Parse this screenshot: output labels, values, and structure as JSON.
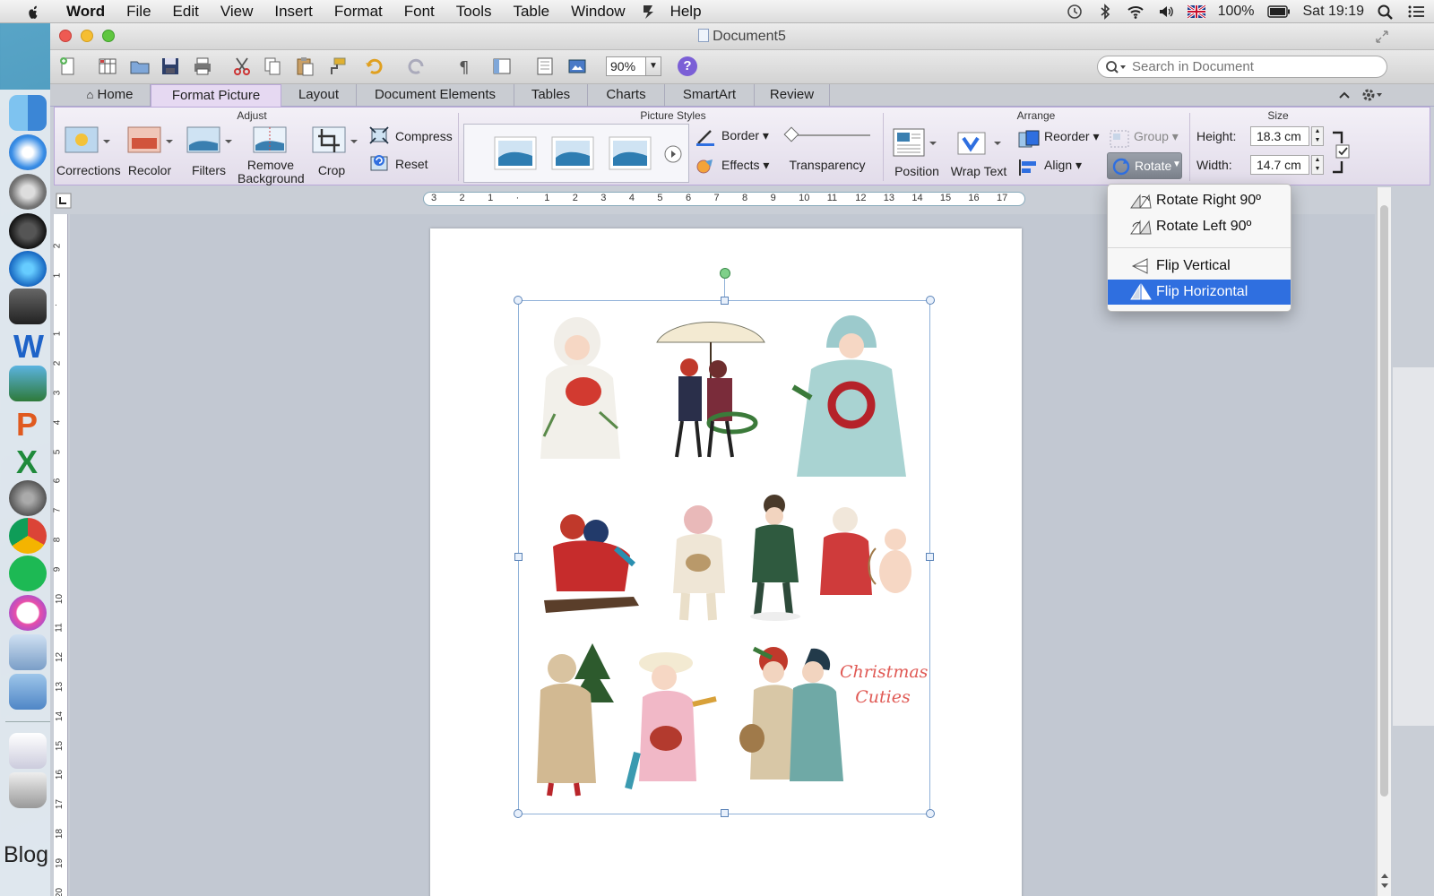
{
  "menubar": {
    "app": "Word",
    "items": [
      "File",
      "Edit",
      "View",
      "Insert",
      "Format",
      "Font",
      "Tools",
      "Table",
      "Window",
      "Help"
    ],
    "status": {
      "battery": "100%",
      "clock": "Sat 19:19"
    }
  },
  "dock": {
    "blog_label": "Blog"
  },
  "window": {
    "title": "Document5"
  },
  "toolbar": {
    "zoom": "90%",
    "help": "?",
    "search_placeholder": "Search in Document"
  },
  "ribbon_tabs": [
    "Home",
    "Format Picture",
    "Layout",
    "Document Elements",
    "Tables",
    "Charts",
    "SmartArt",
    "Review"
  ],
  "ribbon": {
    "adjust": {
      "title": "Adjust",
      "corrections": "Corrections",
      "recolor": "Recolor",
      "filters": "Filters",
      "remove_background_1": "Remove",
      "remove_background_2": "Background",
      "crop": "Crop",
      "compress": "Compress",
      "reset": "Reset"
    },
    "picture_styles": {
      "title": "Picture Styles",
      "border": "Border",
      "effects": "Effects",
      "transparency": "Transparency"
    },
    "arrange": {
      "title": "Arrange",
      "position": "Position",
      "wrap_text": "Wrap Text",
      "reorder": "Reorder",
      "align": "Align",
      "group": "Group",
      "rotate": "Rotate"
    },
    "size": {
      "title": "Size",
      "height_label": "Height:",
      "height_value": "18.3 cm",
      "width_label": "Width:",
      "width_value": "14.7 cm"
    }
  },
  "ruler": {
    "h_labels": [
      "3",
      "2",
      "1",
      "",
      "1",
      "2",
      "3",
      "4",
      "5",
      "6",
      "7",
      "8",
      "9",
      "10",
      "11",
      "12",
      "13",
      "14",
      "15",
      "16",
      "17"
    ],
    "v_labels": [
      "2",
      "1",
      "",
      "1",
      "2",
      "3",
      "4",
      "5",
      "6",
      "7",
      "8",
      "9",
      "10",
      "11",
      "12",
      "13",
      "14",
      "15",
      "16",
      "17",
      "18",
      "19",
      "20"
    ]
  },
  "document": {
    "caption_line1": "Christmas",
    "caption_line2": "Cuties"
  },
  "rotate_menu": {
    "items": [
      {
        "label": "Rotate Right 90º",
        "selected": false
      },
      {
        "label": "Rotate Left 90º",
        "selected": false
      },
      {
        "label": "Flip Vertical",
        "selected": false
      },
      {
        "label": "Flip Horizontal",
        "selected": true
      }
    ]
  },
  "colors": {
    "ribbon_accent": "#b9a8d8",
    "selection_blue": "#2f6fe0",
    "caption_red": "#e05a55"
  }
}
